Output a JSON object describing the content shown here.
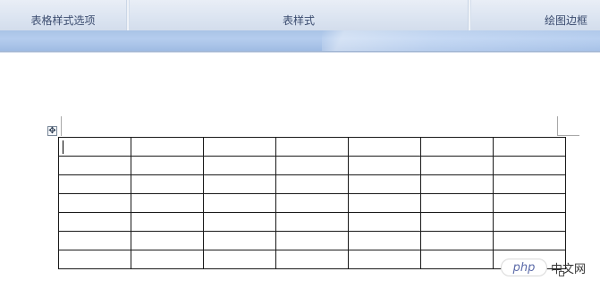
{
  "ribbon": {
    "groups": [
      {
        "label": "表格样式选项"
      },
      {
        "label": "表样式"
      },
      {
        "label": "绘图边框"
      }
    ]
  },
  "table": {
    "rows": 7,
    "cols": 7,
    "move_handle_glyph": "✥"
  },
  "watermark": {
    "logo": "php",
    "text": "中文网"
  }
}
